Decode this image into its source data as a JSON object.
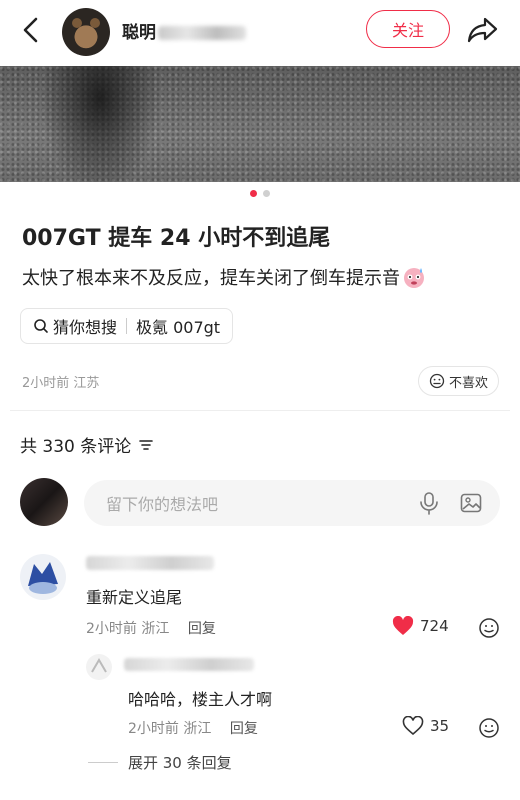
{
  "header": {
    "author_name": "聪明",
    "follow_label": "关注"
  },
  "post": {
    "title": "007GT 提车 24 小时不到追尾",
    "description": "太快了根本来不及反应，提车关闭了倒车提示音",
    "search_prefix": "猜你想搜",
    "search_query": "极氪 007gt",
    "time": "2小时前",
    "location": "江苏",
    "dislike_label": "不喜欢"
  },
  "comments": {
    "count_label": "共 330 条评论",
    "input_placeholder": "留下你的想法吧",
    "items": [
      {
        "text": "重新定义追尾",
        "time": "2小时前",
        "location": "浙江",
        "reply_label": "回复",
        "likes": "724",
        "liked": true,
        "reply": {
          "text": "哈哈哈，楼主人才啊",
          "time": "2小时前",
          "location": "浙江",
          "reply_label": "回复",
          "likes": "35"
        },
        "expand_label": "展开 30 条回复"
      }
    ]
  },
  "colors": {
    "accent": "#f02d48",
    "meta_text": "#999999"
  },
  "carousel": {
    "total": 2,
    "current": 1
  }
}
